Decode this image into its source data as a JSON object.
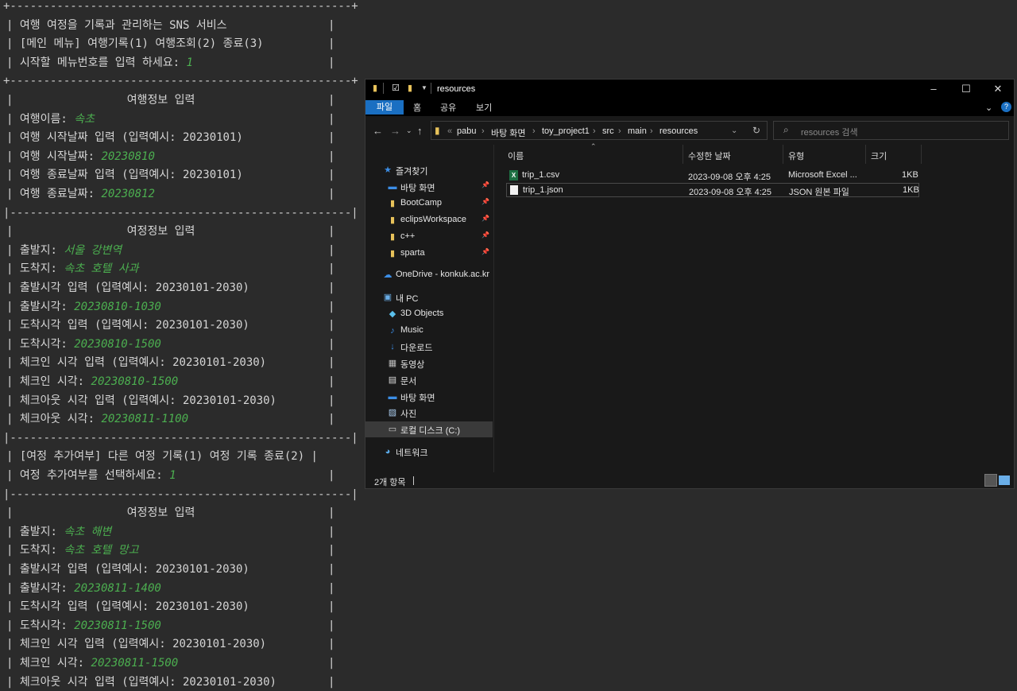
{
  "console": {
    "lines": [
      {
        "kind": "sep",
        "text": "+---------------------------------------------------+"
      },
      {
        "kind": "text",
        "text": "| 여행 여정을 기록과 관리하는 SNS 서비스",
        "bar": true
      },
      {
        "kind": "text",
        "text": "| [메인 메뉴] 여행기록(1) 여행조회(2) 종료(3)",
        "bar": true
      },
      {
        "kind": "text",
        "text": "| 시작할 메뉴번호를 입력 하세요: ",
        "input": "1",
        "bar": false
      },
      {
        "kind": "sep",
        "text": "+---------------------------------------------------+"
      },
      {
        "kind": "text",
        "text": "|                 여행정보 입력",
        "bar": true
      },
      {
        "kind": "text",
        "text": "| 여행이름: ",
        "input": "속초",
        "bar": false
      },
      {
        "kind": "text",
        "text": "| 여행 시작날짜 입력 (입력예시: 20230101)",
        "bar": true
      },
      {
        "kind": "text",
        "text": "| 여행 시작날짜: ",
        "input": "20230810",
        "bar": false
      },
      {
        "kind": "text",
        "text": "| 여행 종료날짜 입력 (입력예시: 20230101)",
        "bar": true
      },
      {
        "kind": "text",
        "text": "| 여행 종료날짜: ",
        "input": "20230812",
        "bar": false
      },
      {
        "kind": "sep",
        "text": "|---------------------------------------------------|"
      },
      {
        "kind": "text",
        "text": "|                 여정정보 입력",
        "bar": true
      },
      {
        "kind": "text",
        "text": "| 출발지: ",
        "input": "서울 강변역",
        "bar": false
      },
      {
        "kind": "text",
        "text": "| 도착지: ",
        "input": "속초 호텔 사과",
        "bar": false
      },
      {
        "kind": "text",
        "text": "| 출발시각 입력 (입력예시: 20230101-2030)",
        "bar": true
      },
      {
        "kind": "text",
        "text": "| 출발시각: ",
        "input": "20230810-1030",
        "bar": false
      },
      {
        "kind": "text",
        "text": "| 도착시각 입력 (입력예시: 20230101-2030)",
        "bar": true
      },
      {
        "kind": "text",
        "text": "| 도착시각: ",
        "input": "20230810-1500",
        "bar": false
      },
      {
        "kind": "text",
        "text": "| 체크인 시각 입력 (입력예시: 20230101-2030)",
        "bar": true
      },
      {
        "kind": "text",
        "text": "| 체크인 시각: ",
        "input": "20230810-1500",
        "bar": false
      },
      {
        "kind": "text",
        "text": "| 체크아웃 시각 입력 (입력예시: 20230101-2030)",
        "bar": true
      },
      {
        "kind": "text",
        "text": "| 체크아웃 시각: ",
        "input": "20230811-1100",
        "bar": false
      },
      {
        "kind": "sep",
        "text": "|---------------------------------------------------|"
      },
      {
        "kind": "text",
        "text": "| [여정 추가여부] 다른 여정 기록(1) 여정 기록 종료(2) |",
        "bar": false
      },
      {
        "kind": "text",
        "text": "| 여정 추가여부를 선택하세요: ",
        "input": "1",
        "bar": false
      },
      {
        "kind": "sep",
        "text": "|---------------------------------------------------|"
      },
      {
        "kind": "text",
        "text": "|                 여정정보 입력",
        "bar": true
      },
      {
        "kind": "text",
        "text": "| 출발지: ",
        "input": "속초 해변",
        "bar": false
      },
      {
        "kind": "text",
        "text": "| 도착지: ",
        "input": "속초 호텔 망고",
        "bar": false
      },
      {
        "kind": "text",
        "text": "| 출발시각 입력 (입력예시: 20230101-2030)",
        "bar": true
      },
      {
        "kind": "text",
        "text": "| 출발시각: ",
        "input": "20230811-1400",
        "bar": false
      },
      {
        "kind": "text",
        "text": "| 도착시각 입력 (입력예시: 20230101-2030)",
        "bar": true
      },
      {
        "kind": "text",
        "text": "| 도착시각: ",
        "input": "20230811-1500",
        "bar": false
      },
      {
        "kind": "text",
        "text": "| 체크인 시각 입력 (입력예시: 20230101-2030)",
        "bar": true
      },
      {
        "kind": "text",
        "text": "| 체크인 시각: ",
        "input": "20230811-1500",
        "bar": false
      },
      {
        "kind": "text",
        "text": "| 체크아웃 시각 입력 (입력예시: 20230101-2030)",
        "bar": true
      }
    ]
  },
  "explorer": {
    "title": "resources",
    "ribbon_tabs": [
      "파일",
      "홈",
      "공유",
      "보기"
    ],
    "breadcrumb": [
      "pabu",
      "바탕 화면",
      "toy_project1",
      "src",
      "main",
      "resources"
    ],
    "search_placeholder": "resources 검색",
    "nav_items": [
      {
        "label": "즐겨찾기",
        "icon": "star-icon",
        "glyph": "★",
        "color": "#3c8ee6",
        "pinned": false,
        "indent": 1
      },
      {
        "label": "바탕 화면",
        "icon": "desktop-icon",
        "glyph": "▬",
        "color": "#3c8ee6",
        "pinned": true,
        "indent": 2
      },
      {
        "label": "BootCamp",
        "icon": "folder-icon",
        "glyph": "▮",
        "color": "#e8c25a",
        "pinned": true,
        "indent": 2
      },
      {
        "label": "eclipsWorkspace",
        "icon": "folder-icon",
        "glyph": "▮",
        "color": "#e8c25a",
        "pinned": true,
        "indent": 2
      },
      {
        "label": "c++",
        "icon": "folder-icon",
        "glyph": "▮",
        "color": "#e8c25a",
        "pinned": true,
        "indent": 2
      },
      {
        "label": "sparta",
        "icon": "folder-icon",
        "glyph": "▮",
        "color": "#e8c25a",
        "pinned": true,
        "indent": 2
      },
      {
        "label": "OneDrive - konkuk.ac.kr",
        "icon": "cloud-icon",
        "glyph": "☁",
        "color": "#3c8ee6",
        "pinned": false,
        "indent": 1
      },
      {
        "label": "내 PC",
        "icon": "computer-icon",
        "glyph": "▣",
        "color": "#6aaee8",
        "pinned": false,
        "indent": 1
      },
      {
        "label": "3D Objects",
        "icon": "cube-icon",
        "glyph": "◆",
        "color": "#5bc0eb",
        "pinned": false,
        "indent": 2
      },
      {
        "label": "Music",
        "icon": "music-icon",
        "glyph": "♪",
        "color": "#3c8ee6",
        "pinned": false,
        "indent": 2
      },
      {
        "label": "다운로드",
        "icon": "download-icon",
        "glyph": "↓",
        "color": "#3c8ee6",
        "pinned": false,
        "indent": 2
      },
      {
        "label": "동영상",
        "icon": "video-icon",
        "glyph": "▦",
        "color": "#bbbbbb",
        "pinned": false,
        "indent": 2
      },
      {
        "label": "문서",
        "icon": "document-icon",
        "glyph": "▤",
        "color": "#dddddd",
        "pinned": false,
        "indent": 2
      },
      {
        "label": "바탕 화면",
        "icon": "desktop-icon",
        "glyph": "▬",
        "color": "#3c8ee6",
        "pinned": false,
        "indent": 2
      },
      {
        "label": "사진",
        "icon": "picture-icon",
        "glyph": "▨",
        "color": "#aaccee",
        "pinned": false,
        "indent": 2
      },
      {
        "label": "로컬 디스크 (C:)",
        "icon": "drive-icon",
        "glyph": "▭",
        "color": "#cccccc",
        "pinned": false,
        "indent": 2,
        "selected": true
      },
      {
        "label": "네트워크",
        "icon": "network-icon",
        "glyph": "◕",
        "color": "#5aa9e6",
        "pinned": false,
        "indent": 1
      }
    ],
    "columns": [
      "이름",
      "수정한 날짜",
      "유형",
      "크기"
    ],
    "files": [
      {
        "name": "trip_1.csv",
        "icon": "excel-file-icon",
        "modified": "2023-09-08 오후 4:25",
        "type": "Microsoft Excel ...",
        "size": "1KB",
        "selected": false
      },
      {
        "name": "trip_1.json",
        "icon": "text-file-icon",
        "modified": "2023-09-08 오후 4:25",
        "type": "JSON 원본 파일",
        "size": "1KB",
        "selected": true
      }
    ],
    "status": "2개 항목"
  }
}
